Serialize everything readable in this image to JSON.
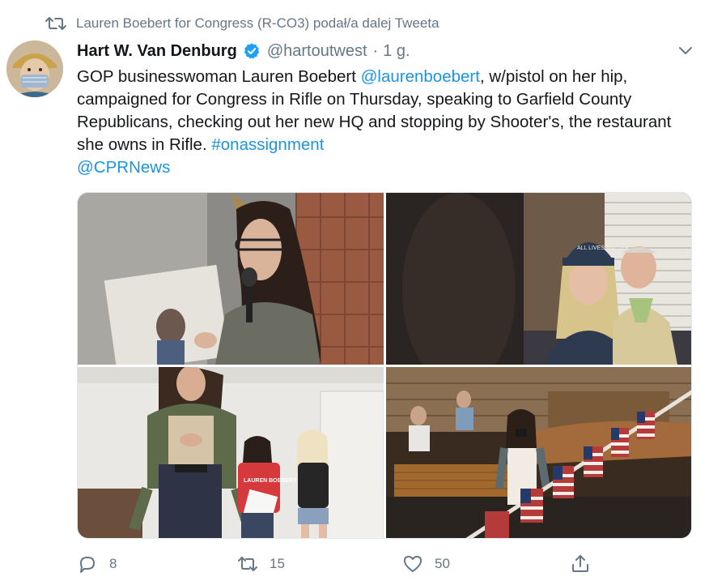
{
  "retweet_context": {
    "text": "Lauren Boebert for Congress (R-CO3) podał/a dalej Tweeta"
  },
  "author": {
    "name": "Hart W. Van Denburg",
    "handle": "@hartoutwest",
    "separator": "·",
    "time": "1 g."
  },
  "tweet": {
    "text_1": "GOP businesswoman Lauren Boebert ",
    "mention_1": "@laurenboebert",
    "text_2": ", w/pistol on her hip, campaigned for Congress in Rifle on Thursday, speaking to Garfield County Republicans, checking out her new HQ and stopping by Shooter's, the restaurant she owns in Rifle. ",
    "hashtag": "#onassignment",
    "mention_2": "@CPRNews"
  },
  "photos": [
    {
      "subject": "woman speaking into microphone holding campaign sign"
    },
    {
      "subject": "audience members wearing caps seated at tables",
      "cap_text": "ALL LIVES MATTER"
    },
    {
      "subject": "woman standing with two supporters",
      "shirt_text": "LAUREN BOEBERT"
    },
    {
      "subject": "restaurant interior with American flag bunting"
    }
  ],
  "actions": {
    "replies": "8",
    "retweets": "15",
    "likes": "50"
  },
  "colors": {
    "link": "#1b95e0",
    "muted": "#657786",
    "verified": "#1da1f2",
    "text": "#14171a"
  },
  "icons": {
    "retweet": "retweet-icon",
    "reply": "reply-icon",
    "like": "heart-icon",
    "share": "share-icon",
    "menu": "chevron-down-icon",
    "verified": "verified-badge-icon"
  }
}
